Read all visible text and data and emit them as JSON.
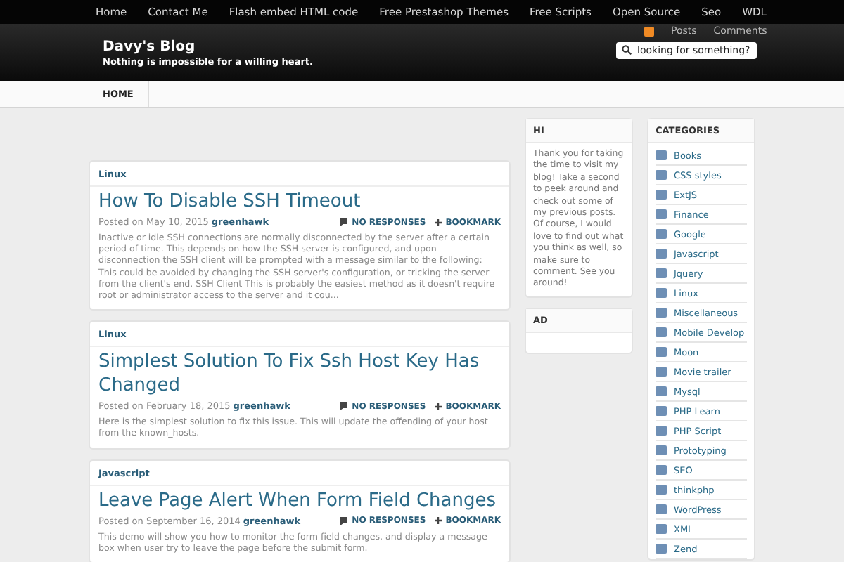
{
  "top_nav": [
    "Home",
    "Contact Me",
    "Flash embed HTML code",
    "Free Prestashop Themes",
    "Free Scripts",
    "Open Source",
    "Seo",
    "WDL"
  ],
  "feeds": [
    "Posts",
    "Comments"
  ],
  "header": {
    "title": "Davy's Blog",
    "tagline": "Nothing is impossible for a willing heart.",
    "search": {
      "placeholder": "looking for something?"
    }
  },
  "main_nav": [
    {
      "label": "HOME",
      "selected": true
    }
  ],
  "posts": [
    {
      "category": "Linux",
      "title": "How To Disable SSH Timeout",
      "posted": "Posted on May 10, 2015",
      "author": "greenhawk",
      "responses": "NO RESPONSES",
      "bookmark": "BOOKMARK",
      "excerpt": "Inactive or idle SSH connections are normally disconnected by the server after a certain period of time. This depends on how the SSH server is configured, and upon disconnection the SSH client will be prompted with a message similar to the following: This could be avoided by changing the SSH server's configuration, or tricking the server from the client's end. SSH Client This is probably the easiest method as it doesn't require root or administrator access to the server and it cou..."
    },
    {
      "category": "Linux",
      "title": "Simplest Solution To Fix Ssh Host Key Has Changed",
      "posted": "Posted on February 18, 2015",
      "author": "greenhawk",
      "responses": "NO RESPONSES",
      "bookmark": "BOOKMARK",
      "excerpt": "Here is the simplest solution to fix this issue. This will update the offending of your host from the known_hosts."
    },
    {
      "category": "Javascript",
      "title": "Leave Page Alert When Form Field Changes",
      "posted": "Posted on September 16, 2014",
      "author": "greenhawk",
      "responses": "NO RESPONSES",
      "bookmark": "BOOKMARK",
      "excerpt": "This demo will show you how to monitor the form field changes, and display a message box when user try to leave the page before the submit form."
    }
  ],
  "widgets": [
    {
      "title": "HI",
      "text": "Thank you for taking the time to visit my blog! Take a second to peek around and check out some of my previous posts. Of course, I would love to find out what you think as well, so make sure to comment. See you around!"
    },
    {
      "title": "AD"
    }
  ],
  "categories": {
    "title": "CATEGORIES",
    "items": [
      "Books",
      "CSS styles",
      "ExtJS",
      "Finance",
      "Google",
      "Javascript",
      "Jquery",
      "Linux",
      "Miscellaneous",
      "Mobile Develop",
      "Moon",
      "Movie trailer",
      "Mysql",
      "PHP Learn",
      "PHP Script",
      "Prototyping",
      "SEO",
      "thinkphp",
      "WordPress",
      "XML",
      "Zend"
    ]
  }
}
